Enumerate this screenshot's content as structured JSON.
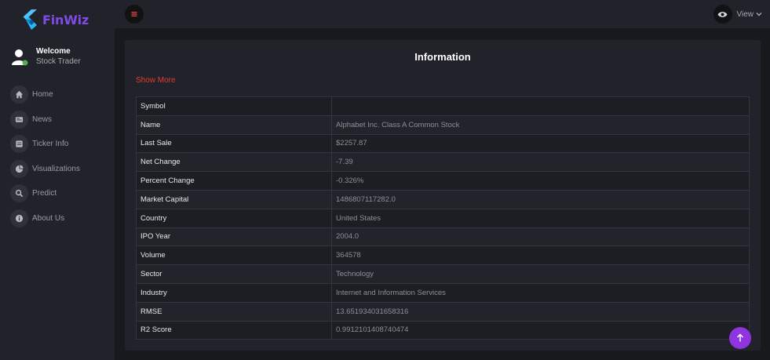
{
  "brand": {
    "name": "FinWiz",
    "logo_icon": "flutter-logo-icon",
    "color": "#7f4be6"
  },
  "user": {
    "welcome": "Welcome",
    "role": "Stock Trader"
  },
  "nav": [
    {
      "label": "Home",
      "icon": "home-icon"
    },
    {
      "label": "News",
      "icon": "news-icon"
    },
    {
      "label": "Ticker Info",
      "icon": "ticker-icon"
    },
    {
      "label": "Visualizations",
      "icon": "pie-chart-icon"
    },
    {
      "label": "Predict",
      "icon": "search-icon"
    },
    {
      "label": "About Us",
      "icon": "info-icon"
    }
  ],
  "topbar": {
    "menu_icon": "hamburger-icon",
    "menu_color": "#e53935",
    "view_label": "View"
  },
  "info": {
    "title": "Information",
    "show_more": "Show More",
    "rows": [
      {
        "key": "Symbol",
        "value": ""
      },
      {
        "key": "Name",
        "value": "Alphabet Inc. Class A Common Stock"
      },
      {
        "key": "Last Sale",
        "value": "$2257.87"
      },
      {
        "key": "Net Change",
        "value": "-7.39"
      },
      {
        "key": "Percent Change",
        "value": "-0.326%"
      },
      {
        "key": "Market Capital",
        "value": "1486807117282.0"
      },
      {
        "key": "Country",
        "value": "United States"
      },
      {
        "key": "IPO Year",
        "value": "2004.0"
      },
      {
        "key": "Volume",
        "value": "364578"
      },
      {
        "key": "Sector",
        "value": "Technology"
      },
      {
        "key": "Industry",
        "value": "Internet and Information Services"
      },
      {
        "key": "RMSE",
        "value": "13.651934031658316"
      },
      {
        "key": "R2 Score",
        "value": "0.9912101408740474"
      }
    ]
  },
  "colors": {
    "accent": "#8e35e0",
    "show_more": "#e53935"
  }
}
